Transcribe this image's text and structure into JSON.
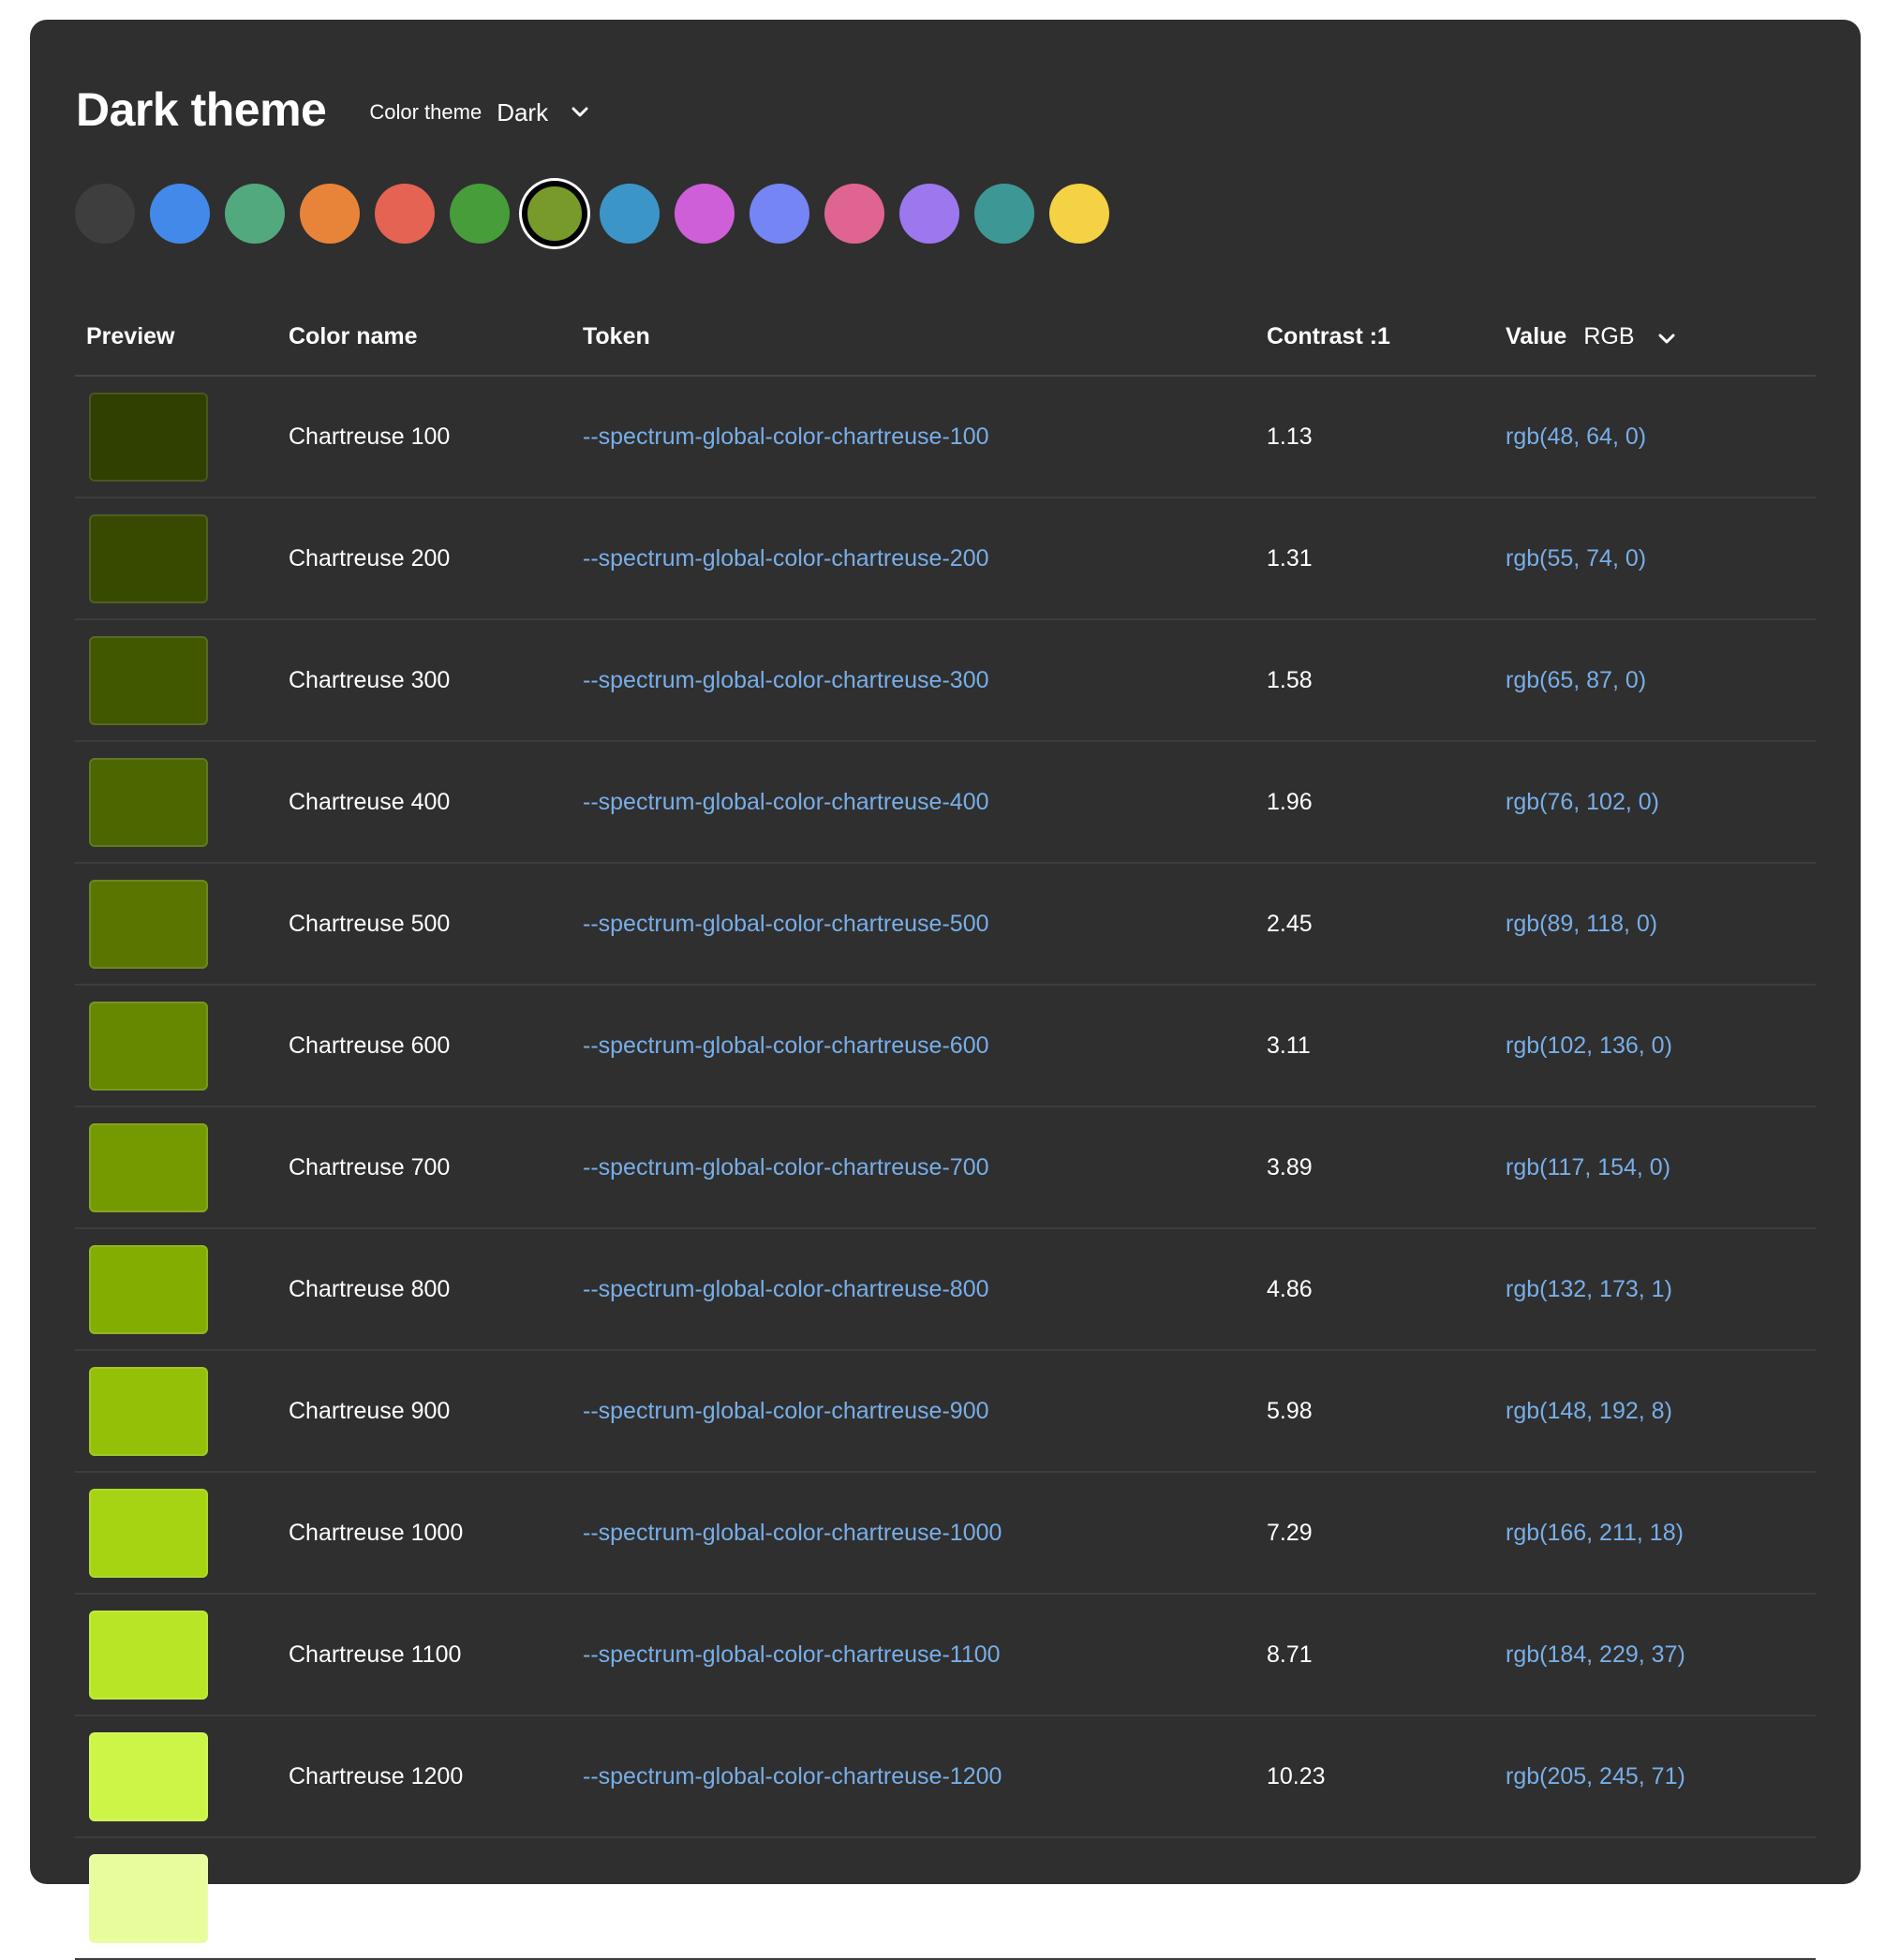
{
  "header": {
    "title": "Dark theme",
    "theme_label": "Color theme",
    "theme_value": "Dark"
  },
  "palette": [
    {
      "name": "gray",
      "color": "#3e3e3e",
      "selected": false
    },
    {
      "name": "blue",
      "color": "#4389ea",
      "selected": false
    },
    {
      "name": "seafoam",
      "color": "#53a97e",
      "selected": false
    },
    {
      "name": "orange",
      "color": "#e8843a",
      "selected": false
    },
    {
      "name": "red",
      "color": "#e46352",
      "selected": false
    },
    {
      "name": "green",
      "color": "#479d3a",
      "selected": false
    },
    {
      "name": "chartreuse",
      "color": "#789a2b",
      "selected": true
    },
    {
      "name": "cyan",
      "color": "#3c95c7",
      "selected": false
    },
    {
      "name": "magenta",
      "color": "#cf5fd9",
      "selected": false
    },
    {
      "name": "indigo",
      "color": "#7685f4",
      "selected": false
    },
    {
      "name": "pink",
      "color": "#e06491",
      "selected": false
    },
    {
      "name": "purple",
      "color": "#9c77ee",
      "selected": false
    },
    {
      "name": "teal",
      "color": "#3d9895",
      "selected": false
    },
    {
      "name": "yellow",
      "color": "#f4d243",
      "selected": false
    }
  ],
  "table": {
    "headers": {
      "preview": "Preview",
      "name": "Color name",
      "token": "Token",
      "contrast": "Contrast :1",
      "value": "Value",
      "value_format": "RGB"
    },
    "rows": [
      {
        "name": "Chartreuse 100",
        "token": "--spectrum-global-color-chartreuse-100",
        "contrast": "1.13",
        "value": "rgb(48, 64, 0)",
        "color": "#304000"
      },
      {
        "name": "Chartreuse 200",
        "token": "--spectrum-global-color-chartreuse-200",
        "contrast": "1.31",
        "value": "rgb(55, 74, 0)",
        "color": "#374a00"
      },
      {
        "name": "Chartreuse 300",
        "token": "--spectrum-global-color-chartreuse-300",
        "contrast": "1.58",
        "value": "rgb(65, 87, 0)",
        "color": "#415700"
      },
      {
        "name": "Chartreuse 400",
        "token": "--spectrum-global-color-chartreuse-400",
        "contrast": "1.96",
        "value": "rgb(76, 102, 0)",
        "color": "#4c6600"
      },
      {
        "name": "Chartreuse 500",
        "token": "--spectrum-global-color-chartreuse-500",
        "contrast": "2.45",
        "value": "rgb(89, 118, 0)",
        "color": "#597600"
      },
      {
        "name": "Chartreuse 600",
        "token": "--spectrum-global-color-chartreuse-600",
        "contrast": "3.11",
        "value": "rgb(102, 136, 0)",
        "color": "#668800"
      },
      {
        "name": "Chartreuse 700",
        "token": "--spectrum-global-color-chartreuse-700",
        "contrast": "3.89",
        "value": "rgb(117, 154, 0)",
        "color": "#759a00"
      },
      {
        "name": "Chartreuse 800",
        "token": "--spectrum-global-color-chartreuse-800",
        "contrast": "4.86",
        "value": "rgb(132, 173, 1)",
        "color": "#84ad01"
      },
      {
        "name": "Chartreuse 900",
        "token": "--spectrum-global-color-chartreuse-900",
        "contrast": "5.98",
        "value": "rgb(148, 192, 8)",
        "color": "#94c008"
      },
      {
        "name": "Chartreuse 1000",
        "token": "--spectrum-global-color-chartreuse-1000",
        "contrast": "7.29",
        "value": "rgb(166, 211, 18)",
        "color": "#a6d312"
      },
      {
        "name": "Chartreuse 1100",
        "token": "--spectrum-global-color-chartreuse-1100",
        "contrast": "8.71",
        "value": "rgb(184, 229, 37)",
        "color": "#b8e525"
      },
      {
        "name": "Chartreuse 1200",
        "token": "--spectrum-global-color-chartreuse-1200",
        "contrast": "10.23",
        "value": "rgb(205, 245, 71)",
        "color": "#cdf547"
      },
      {
        "name": "",
        "token": "",
        "contrast": "",
        "value": "",
        "color": "#e8fc9e"
      }
    ]
  }
}
